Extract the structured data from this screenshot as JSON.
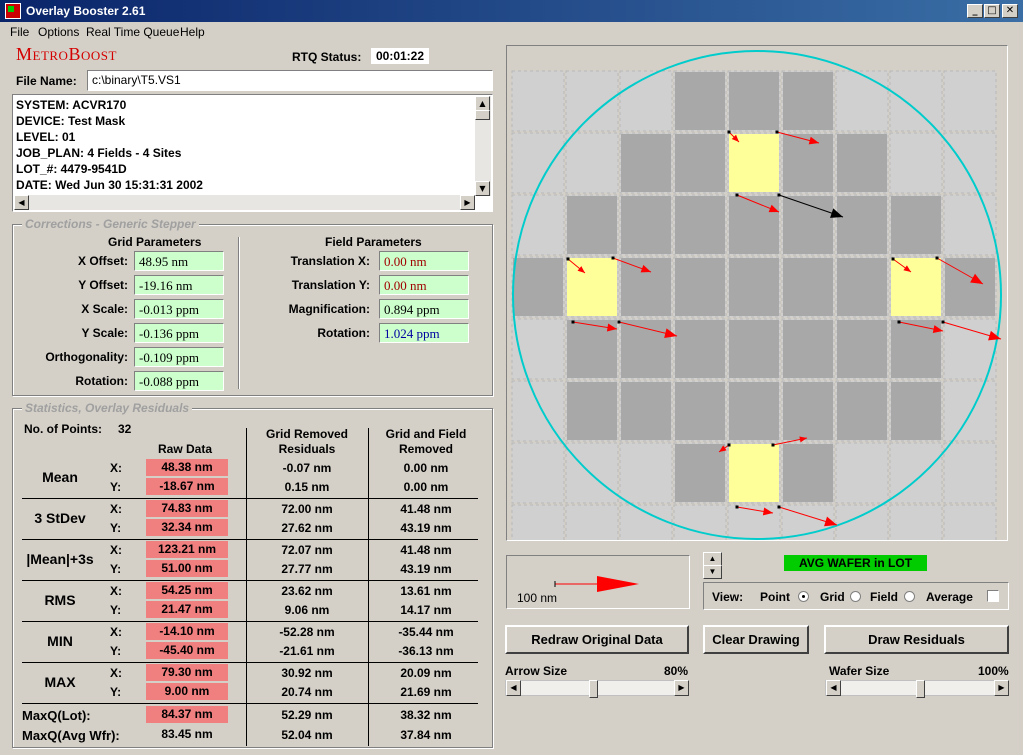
{
  "window": {
    "title": "Overlay Booster 2.61"
  },
  "menu": [
    "File",
    "Options",
    "Real Time Queue",
    "Help"
  ],
  "brand": "MetroBoost",
  "rtq": {
    "label": "RTQ Status:",
    "value": "00:01:22"
  },
  "file": {
    "label": "File Name:",
    "value": "c:\\binary\\T5.VS1"
  },
  "info_lines": [
    "SYSTEM: ACVR170",
    "DEVICE: Test Mask",
    "LEVEL: 01",
    "JOB_PLAN: 4 Fields - 4 Sites",
    "LOT_#: 4479-9541D",
    "DATE: Wed Jun 30 15:31:31 2002"
  ],
  "corrections": {
    "title": "Corrections - Generic Stepper",
    "grid_header": "Grid Parameters",
    "field_header": "Field Parameters",
    "grid": [
      {
        "label": "X Offset:",
        "value": "48.95 nm",
        "color": "#000000"
      },
      {
        "label": "Y Offset:",
        "value": "-19.16 nm",
        "color": "#000000"
      },
      {
        "label": "X Scale:",
        "value": "-0.013 ppm",
        "color": "#000000"
      },
      {
        "label": "Y Scale:",
        "value": "-0.136 ppm",
        "color": "#000000"
      },
      {
        "label": "Orthogonality:",
        "value": "-0.109 ppm",
        "color": "#000000"
      },
      {
        "label": "Rotation:",
        "value": "-0.088 ppm",
        "color": "#000000"
      }
    ],
    "field": [
      {
        "label": "Translation X:",
        "value": "0.00 nm",
        "color": "#a00000"
      },
      {
        "label": "Translation Y:",
        "value": "0.00 nm",
        "color": "#a00000"
      },
      {
        "label": "Magnification:",
        "value": "0.894 ppm",
        "color": "#000000"
      },
      {
        "label": "Rotation:",
        "value": "1.024 ppm",
        "color": "#0000a0"
      }
    ]
  },
  "stats": {
    "title": "Statistics, Overlay Residuals",
    "points_label": "No. of Points:",
    "points_value": "32",
    "col_raw": "Raw Data",
    "col_grid_1": "Grid Removed",
    "col_grid_2": "Residuals",
    "col_gf_1": "Grid and Field",
    "col_gf_2": "Removed",
    "rows": [
      {
        "name": "Mean",
        "x": [
          "48.38 nm",
          "-0.07 nm",
          "0.00 nm"
        ],
        "y": [
          "-18.67 nm",
          "0.15 nm",
          "0.00 nm"
        ]
      },
      {
        "name": "3 StDev",
        "x": [
          "74.83 nm",
          "72.00 nm",
          "41.48 nm"
        ],
        "y": [
          "32.34 nm",
          "27.62 nm",
          "43.19 nm"
        ]
      },
      {
        "name": "|Mean|+3s",
        "x": [
          "123.21 nm",
          "72.07 nm",
          "41.48 nm"
        ],
        "y": [
          "51.00 nm",
          "27.77 nm",
          "43.19 nm"
        ]
      },
      {
        "name": "RMS",
        "x": [
          "54.25 nm",
          "23.62 nm",
          "13.61 nm"
        ],
        "y": [
          "21.47 nm",
          "9.06 nm",
          "14.17 nm"
        ]
      },
      {
        "name": "MIN",
        "x": [
          "-14.10 nm",
          "-52.28 nm",
          "-35.44 nm"
        ],
        "y": [
          "-45.40 nm",
          "-21.61 nm",
          "-36.13 nm"
        ]
      },
      {
        "name": "MAX",
        "x": [
          "79.30 nm",
          "30.92 nm",
          "20.09 nm"
        ],
        "y": [
          "9.00 nm",
          "20.74 nm",
          "21.69 nm"
        ]
      }
    ],
    "maxq_lot": {
      "label": "MaxQ(Lot):",
      "values": [
        "84.37 nm",
        "52.29 nm",
        "38.32 nm"
      ]
    },
    "maxq_wfr": {
      "label": "MaxQ(Avg Wfr):",
      "values": [
        "83.45 nm",
        "52.04 nm",
        "37.84 nm"
      ]
    },
    "x_label": "X:",
    "y_label": "Y:"
  },
  "legend": {
    "scale_label": "100 nm"
  },
  "avg_badge": "AVG WAFER in LOT",
  "view": {
    "label": "View:",
    "options": [
      "Point",
      "Grid",
      "Field"
    ],
    "selected": "Point",
    "average_label": "Average"
  },
  "buttons": {
    "redraw": "Redraw Original Data",
    "clear": "Clear Drawing",
    "draw": "Draw Residuals"
  },
  "arrow_size": {
    "label": "Arrow Size",
    "value": "80%"
  },
  "wafer_size": {
    "label": "Wafer Size",
    "value": "100%"
  },
  "colors": {
    "wafer_outline": "#00cccc",
    "field_highlight": "#ffff99",
    "arrow": "#ff0000",
    "badge": "#00cc00"
  }
}
